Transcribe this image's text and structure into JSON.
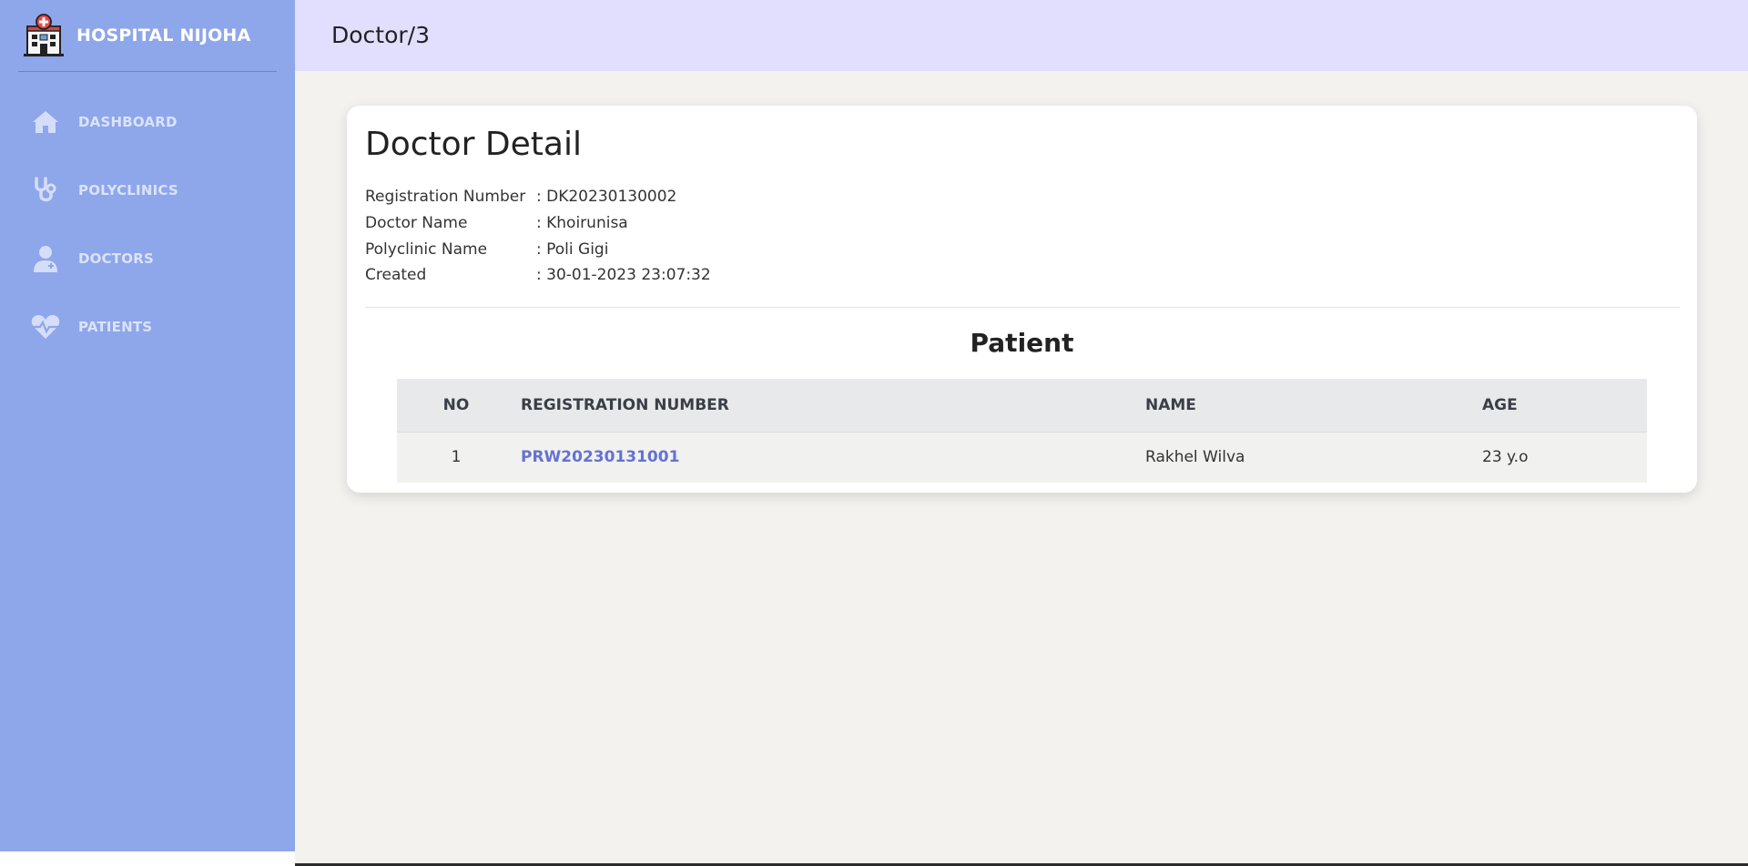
{
  "brand": {
    "name": "HOSPITAL NIJOHA",
    "logo": "hospital-building-icon"
  },
  "sidebar": {
    "items": [
      {
        "label": "DASHBOARD",
        "icon": "home-icon"
      },
      {
        "label": "POLYCLINICS",
        "icon": "stethoscope-icon"
      },
      {
        "label": "DOCTORS",
        "icon": "doctor-icon"
      },
      {
        "label": "PATIENTS",
        "icon": "heart-pulse-icon"
      }
    ]
  },
  "header": {
    "breadcrumb": "Doctor/3"
  },
  "detail": {
    "title": "Doctor Detail",
    "fields": [
      {
        "label": "Registration Number",
        "value": ": DK20230130002"
      },
      {
        "label": "Doctor Name",
        "value": ": Khoirunisa"
      },
      {
        "label": "Polyclinic Name",
        "value": ": Poli Gigi"
      },
      {
        "label": "Created",
        "value": ": 30-01-2023 23:07:32"
      }
    ]
  },
  "patients": {
    "title": "Patient",
    "columns": [
      "NO",
      "REGISTRATION NUMBER",
      "NAME",
      "AGE"
    ],
    "rows": [
      {
        "no": "1",
        "registration_number": "PRW20230131001",
        "name": "Rakhel Wilva",
        "age": "23 y.o"
      }
    ]
  },
  "colors": {
    "sidebar": "#8ea6ea",
    "topbar": "#e1dffd",
    "background": "#f3f2ef",
    "link": "#6472d4"
  }
}
